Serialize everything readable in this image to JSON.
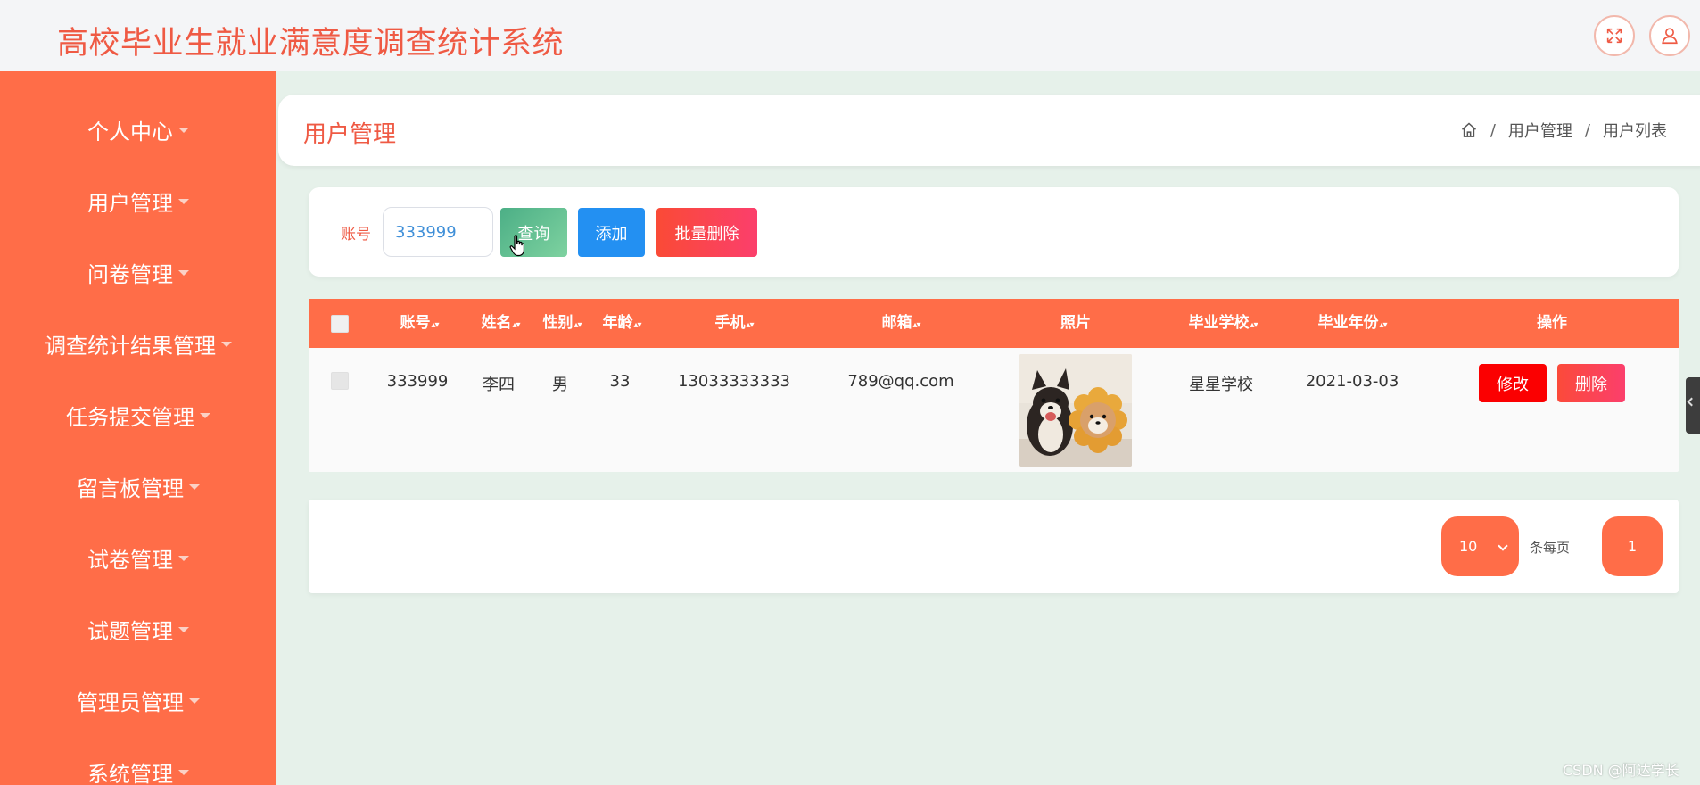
{
  "header": {
    "app_title": "高校毕业生就业满意度调查统计系统",
    "icons": [
      "fullscreen-icon",
      "user-icon"
    ]
  },
  "sidebar": {
    "items": [
      {
        "label": "个人中心"
      },
      {
        "label": "用户管理"
      },
      {
        "label": "问卷管理"
      },
      {
        "label": "调查统计结果管理"
      },
      {
        "label": "任务提交管理"
      },
      {
        "label": "留言板管理"
      },
      {
        "label": "试卷管理"
      },
      {
        "label": "试题管理"
      },
      {
        "label": "管理员管理"
      },
      {
        "label": "系统管理"
      }
    ]
  },
  "page": {
    "title": "用户管理",
    "breadcrumb": [
      "用户管理",
      "用户列表"
    ]
  },
  "search": {
    "label": "账号",
    "value": "333999",
    "query_label": "查询",
    "add_label": "添加",
    "batch_delete_label": "批量删除"
  },
  "table": {
    "headers": {
      "account": "账号",
      "name": "姓名",
      "gender": "性别",
      "age": "年龄",
      "phone": "手机",
      "email": "邮箱",
      "photo": "照片",
      "school": "毕业学校",
      "grad_year": "毕业年份",
      "actions": "操作"
    },
    "rows": [
      {
        "account": "333999",
        "name": "李四",
        "gender": "男",
        "age": "33",
        "phone": "13033333333",
        "email": "789@qq.com",
        "school": "星星学校",
        "grad_year": "2021-03-03",
        "edit_label": "修改",
        "delete_label": "删除"
      }
    ]
  },
  "pagination": {
    "page_size": "10",
    "per_page_label": "条每页",
    "current_page": "1"
  },
  "watermark": "CSDN @阿达学长",
  "colors": {
    "primary": "#ff6d48",
    "title_red": "#ef5a44",
    "add_blue": "#2390f2",
    "edit_red": "#fb0001",
    "background": "#e6f1ea"
  }
}
